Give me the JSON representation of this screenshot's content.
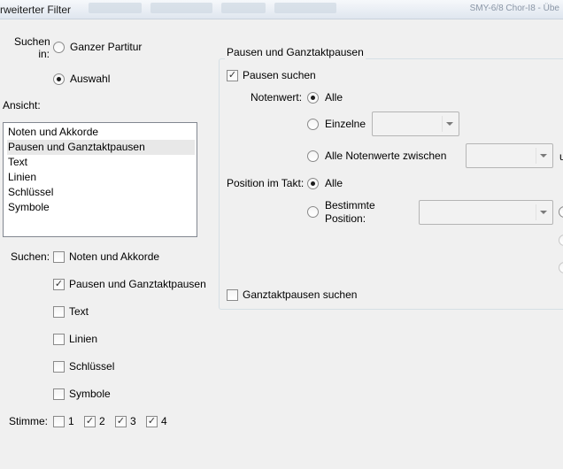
{
  "window": {
    "title": "rweiterter Filter",
    "right_text": "SMY-6/8 Chor-I8 - Übe"
  },
  "search_in": {
    "label": "Suchen in:",
    "options": [
      {
        "label": "Ganzer Partitur",
        "selected": false
      },
      {
        "label": "Auswahl",
        "selected": true
      }
    ]
  },
  "view": {
    "label": "Ansicht:",
    "items": [
      {
        "label": "Noten und Akkorde",
        "selected": false
      },
      {
        "label": "Pausen und Ganztaktpausen",
        "selected": true
      },
      {
        "label": "Text",
        "selected": false
      },
      {
        "label": "Linien",
        "selected": false
      },
      {
        "label": "Schlüssel",
        "selected": false
      },
      {
        "label": "Symbole",
        "selected": false
      }
    ]
  },
  "search": {
    "label": "Suchen:",
    "items": [
      {
        "label": "Noten und Akkorde",
        "checked": false
      },
      {
        "label": "Pausen und Ganztaktpausen",
        "checked": true
      },
      {
        "label": "Text",
        "checked": false
      },
      {
        "label": "Linien",
        "checked": false
      },
      {
        "label": "Schlüssel",
        "checked": false
      },
      {
        "label": "Symbole",
        "checked": false
      }
    ]
  },
  "voice": {
    "label": "Stimme:",
    "items": [
      {
        "label": "1",
        "checked": false
      },
      {
        "label": "2",
        "checked": true
      },
      {
        "label": "3",
        "checked": true
      },
      {
        "label": "4",
        "checked": true
      }
    ]
  },
  "rests_group": {
    "title": "Pausen und Ganztaktpausen",
    "search_rests": {
      "label": "Pausen suchen",
      "checked": true
    },
    "note_value": {
      "label": "Notenwert:",
      "options": [
        {
          "label": "Alle",
          "selected": true
        },
        {
          "label": "Einzelne",
          "selected": false
        },
        {
          "label": "Alle Notenwerte zwischen",
          "selected": false
        }
      ],
      "between_suffix": "u",
      "single_value": "",
      "between_from": ""
    },
    "position": {
      "label": "Position im Takt:",
      "options": [
        {
          "label": "Alle",
          "selected": true
        },
        {
          "label_line1": "Bestimmte",
          "label_line2": "Position:",
          "selected": false
        }
      ],
      "specific_value": ""
    },
    "search_whole_rests": {
      "label": "Ganztaktpausen suchen",
      "checked": false
    }
  },
  "glyphs": {
    "check": "✓"
  }
}
